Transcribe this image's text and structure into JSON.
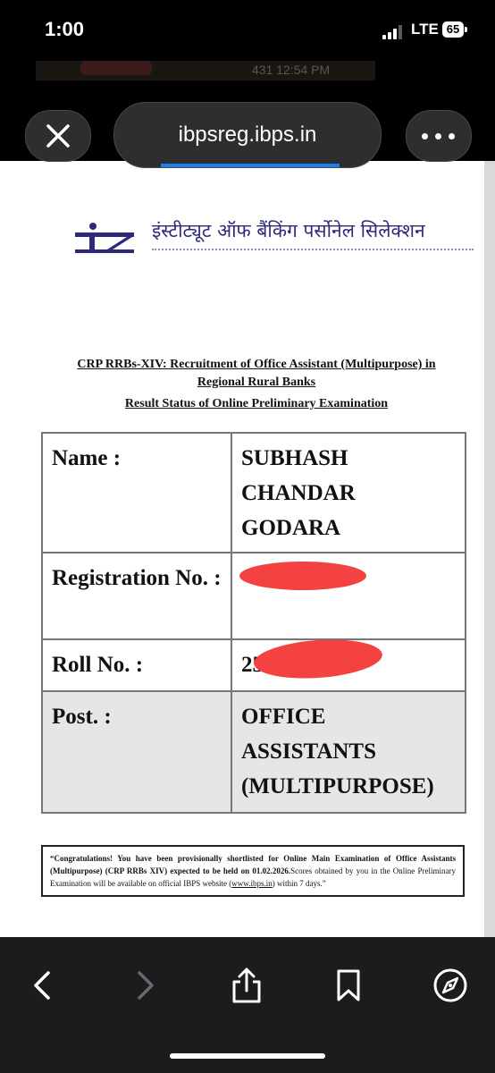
{
  "status_bar": {
    "time": "1:00",
    "network": "LTE",
    "battery": "65"
  },
  "background_strip": {
    "text": "431 12:54 PM"
  },
  "browser": {
    "url": "ibpsreg.ibps.in",
    "buttons": {
      "close": "close",
      "more": "more"
    }
  },
  "document": {
    "org_name_hindi": "इंस्टीट्यूट ऑफ बैंकिंग पर्सोनेल सिलेक्शन",
    "headline_1": "CRP RRBs-XIV: Recruitment of Office Assistant (Multipurpose) in",
    "headline_2": "Regional Rural Banks",
    "headline_3": "Result Status of Online Preliminary Examination",
    "rows": [
      {
        "label": "Name :",
        "value": "SUBHASH CHANDAR GODARA"
      },
      {
        "label": "Registration No. :",
        "value": ""
      },
      {
        "label": "Roll No. :",
        "value": "25"
      },
      {
        "label": "Post. :",
        "value": "OFFICE ASSISTANTS (MULTIPURPOSE)"
      }
    ],
    "notice": {
      "lead": "“Congratulations! You have been provisionally shortlisted for Online Main Examination of Office Assistants (Multipurpose) (CRP RRBs XIV) expected to be held on 01.02.2026.",
      "tail": "Scores obtained by you in the Online Preliminary Examination will be available on official IBPS website (",
      "link": "www.ibps.in",
      "end": ") within 7 days.”"
    }
  },
  "colors": {
    "link_blue": "#1d7cf2",
    "hindi_blue": "#2d2a7a",
    "redaction": "#f44141"
  }
}
